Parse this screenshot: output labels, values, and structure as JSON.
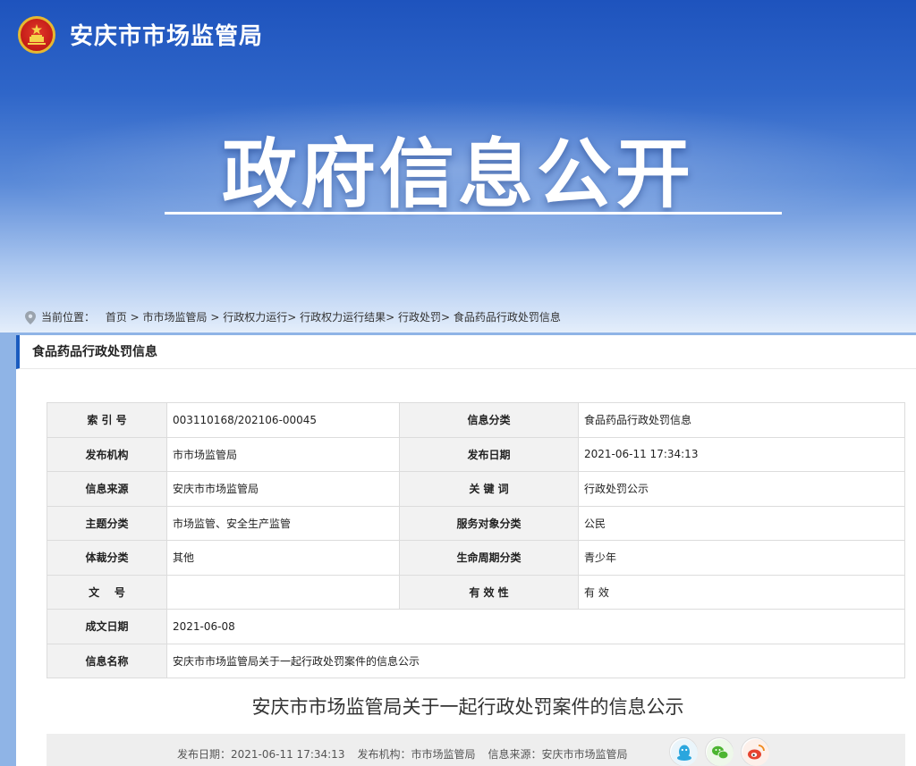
{
  "header": {
    "site_name": "安庆市市场监管局",
    "hero_title": "政府信息公开"
  },
  "breadcrumb": {
    "prefix": "当前位置：",
    "items": [
      "首页",
      "市市场监管局",
      "行政权力运行",
      "行政权力运行结果",
      "行政处罚",
      "食品药品行政处罚信息"
    ],
    "seps": [
      " > ",
      " > ",
      "> ",
      "> ",
      "> "
    ]
  },
  "section_title": "食品药品行政处罚信息",
  "meta": {
    "rows": [
      {
        "k1": "索 引 号",
        "v1": "003110168/202106-00045",
        "k2": "信息分类",
        "v2": "食品药品行政处罚信息"
      },
      {
        "k1": "发布机构",
        "v1": "市市场监管局",
        "k2": "发布日期",
        "v2": "2021-06-11 17:34:13"
      },
      {
        "k1": "信息来源",
        "v1": "安庆市市场监管局",
        "k2": "关 键 词",
        "v2": "行政处罚公示"
      },
      {
        "k1": "主题分类",
        "v1": "市场监管、安全生产监管",
        "k2": "服务对象分类",
        "v2": "公民"
      },
      {
        "k1": "体裁分类",
        "v1": "其他",
        "k2": "生命周期分类",
        "v2": "青少年"
      },
      {
        "k1": "文    号",
        "v1": "",
        "k2": "有 效 性",
        "v2": "有 效"
      }
    ],
    "wide_rows": [
      {
        "k": "成文日期",
        "v": "2021-06-08"
      },
      {
        "k": "信息名称",
        "v": "安庆市市场监管局关于一起行政处罚案件的信息公示"
      }
    ]
  },
  "document": {
    "title": "安庆市市场监管局关于一起行政处罚案件的信息公示",
    "publish_date": "发布日期：2021-06-11 17:34:13",
    "publisher": "发布机构：市市场监管局",
    "source": "信息来源：安庆市市场监管局"
  },
  "share": {
    "icons": [
      "qq-icon",
      "wechat-icon",
      "weibo-icon"
    ]
  },
  "colors": {
    "accent": "#1a5bbf",
    "banner_top": "#1e53bd"
  }
}
